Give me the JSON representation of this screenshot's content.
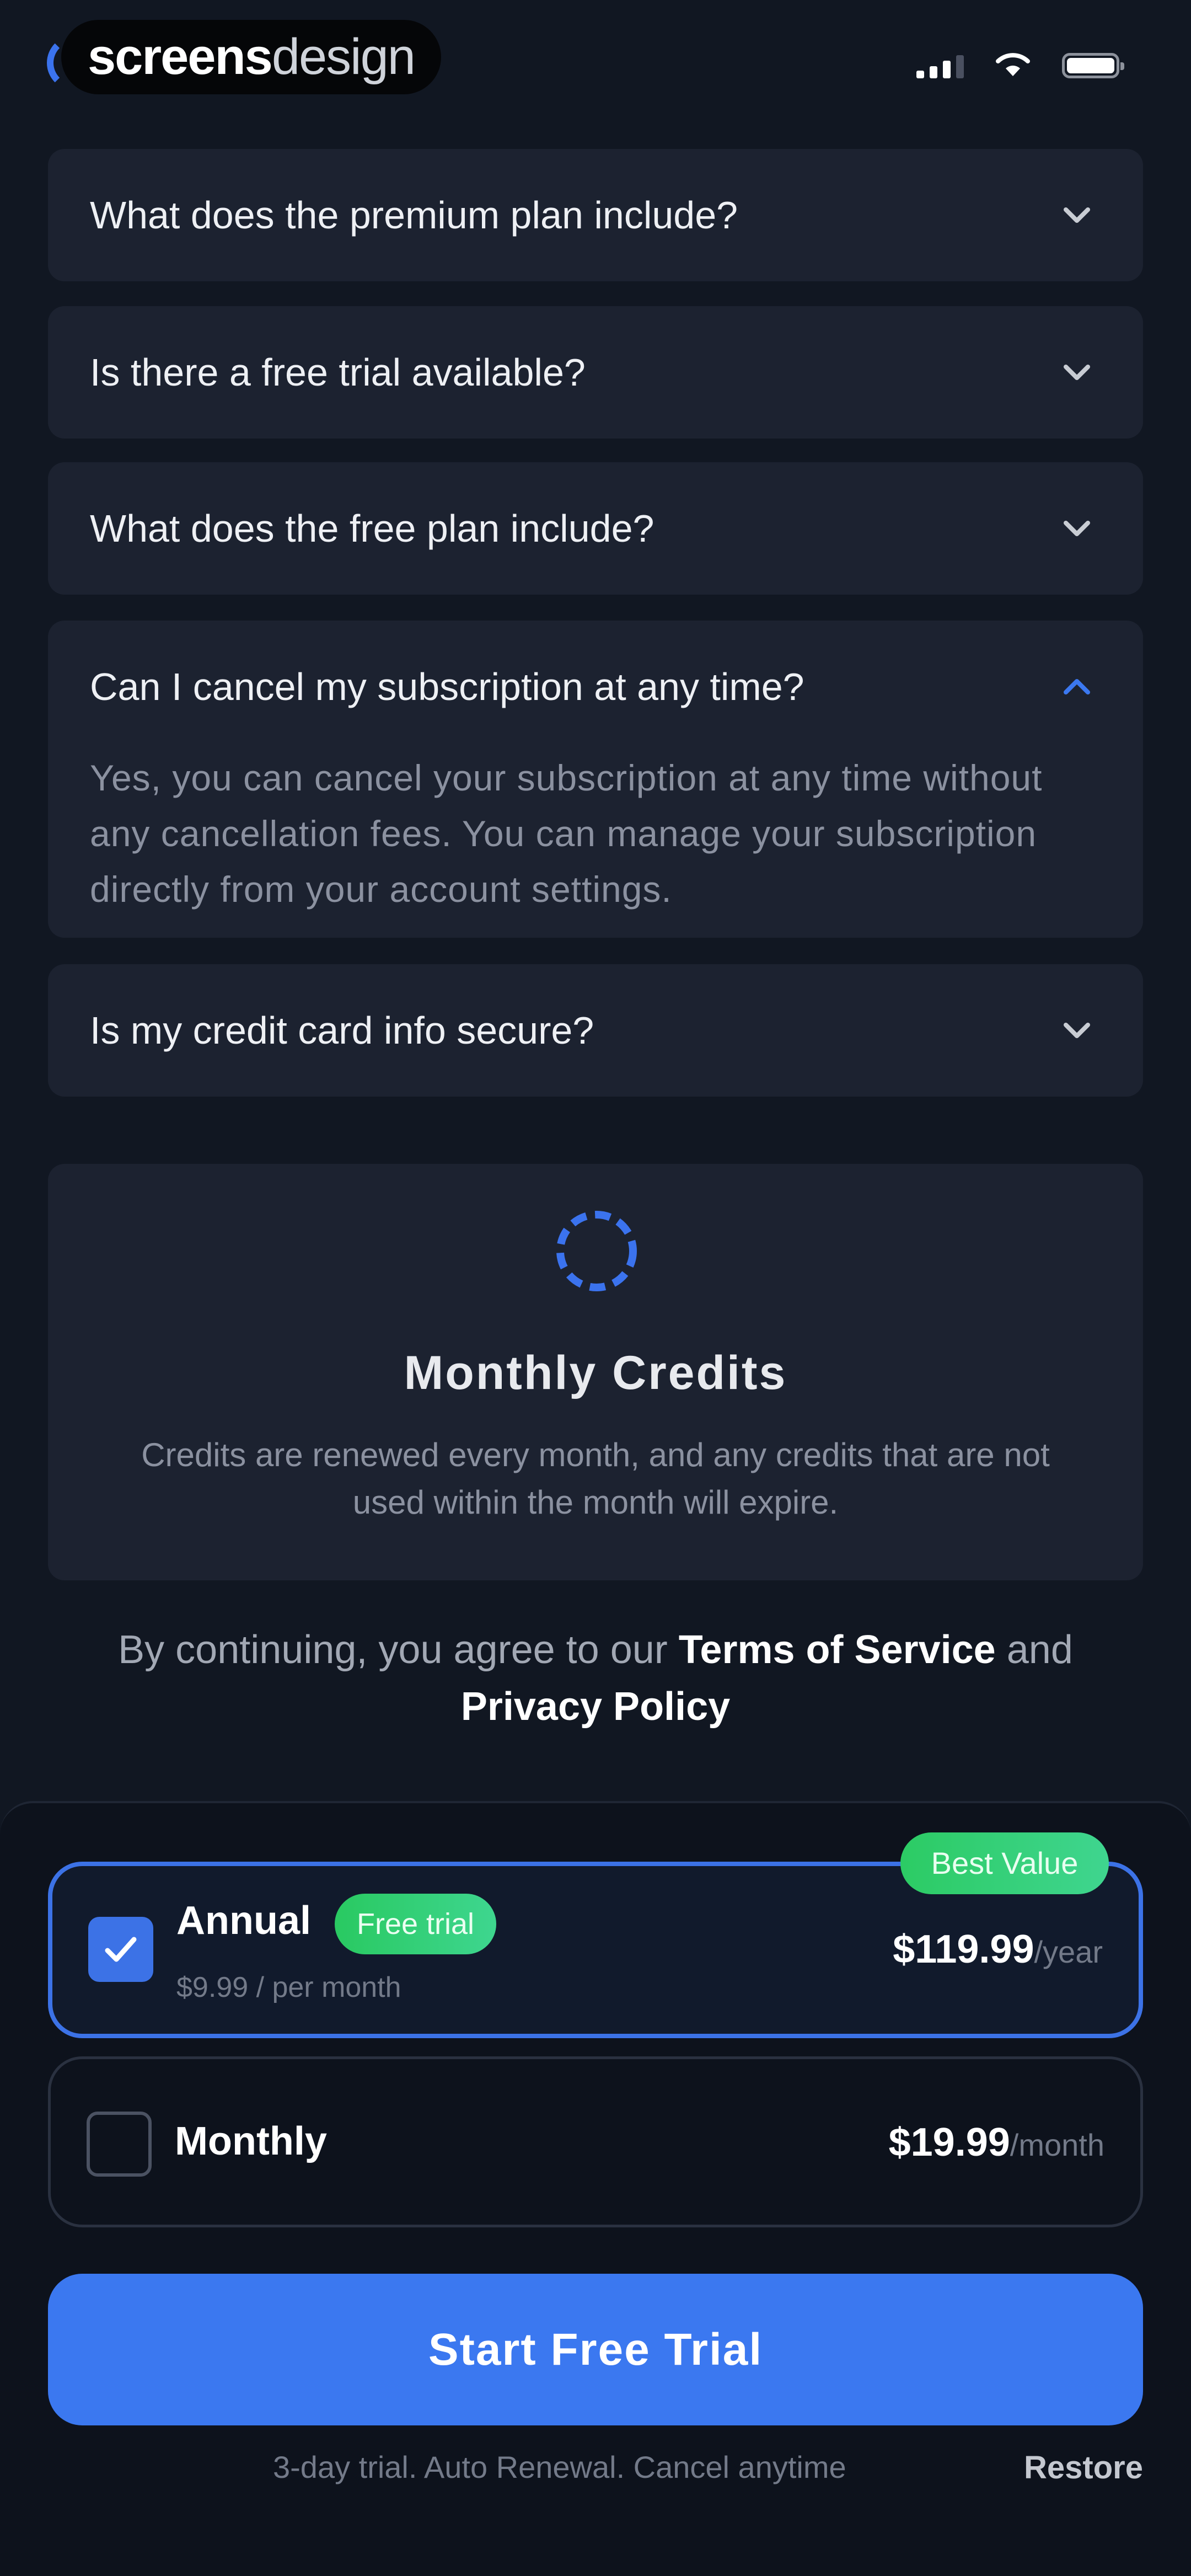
{
  "status_bar": {
    "brand_bold": "screens",
    "brand_light": "design",
    "icons": [
      "signal-icon",
      "wifi-icon",
      "battery-icon"
    ]
  },
  "close": {
    "icon": "close-icon"
  },
  "faq": {
    "items": [
      {
        "question": "What does the premium plan include?",
        "expanded": false
      },
      {
        "question": "Is there a free trial available?",
        "expanded": false
      },
      {
        "question": "What does the free plan include?",
        "expanded": false
      },
      {
        "question": "Can I cancel my subscription at any time?",
        "expanded": true,
        "answer": "Yes, you can cancel your subscription at any time without any cancellation fees. You can manage your subscription directly from your account settings."
      },
      {
        "question": "Is my credit card info secure?",
        "expanded": false
      }
    ]
  },
  "credits": {
    "icon": "refresh-ring-icon",
    "title": "Monthly Credits",
    "description": "Credits are renewed every month, and any credits that are not used within the month will expire."
  },
  "legal": {
    "prefix": "By continuing, you agree to our ",
    "terms": "Terms of Service",
    "conjunction": " and ",
    "privacy": "Privacy Policy"
  },
  "plans": {
    "best_value_badge": "Best Value",
    "annual": {
      "name": "Annual",
      "badge": "Free trial",
      "sub": "$9.99 / per month",
      "price": "$119.99",
      "period": "/year",
      "selected": true
    },
    "monthly": {
      "name": "Monthly",
      "price": "$19.99",
      "period": "/month",
      "selected": false
    }
  },
  "cta": {
    "label": "Start Free Trial"
  },
  "footer": {
    "note": "3-day trial. Auto Renewal. Cancel anytime",
    "restore": "Restore"
  },
  "colors": {
    "background": "#111722",
    "card": "#1c2230",
    "accent_blue": "#3b78f0",
    "badge_green": "#2ccb64"
  }
}
